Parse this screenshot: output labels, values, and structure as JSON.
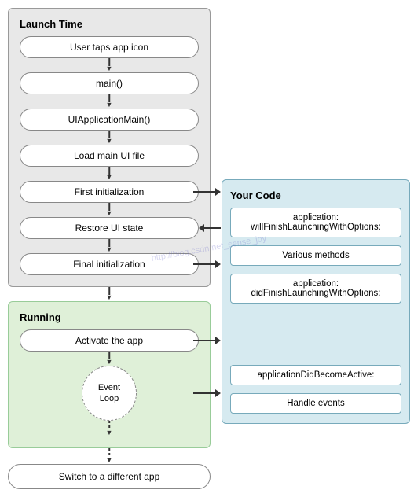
{
  "launch": {
    "label": "Launch Time",
    "boxes": [
      {
        "id": "user-taps",
        "text": "User taps app icon"
      },
      {
        "id": "main",
        "text": "main()"
      },
      {
        "id": "uiappmain",
        "text": "UIApplicationMain()"
      },
      {
        "id": "load-ui",
        "text": "Load main UI file"
      },
      {
        "id": "first-init",
        "text": "First initialization"
      },
      {
        "id": "restore-ui",
        "text": "Restore UI state"
      },
      {
        "id": "final-init",
        "text": "Final initialization"
      }
    ]
  },
  "running": {
    "label": "Running",
    "boxes": [
      {
        "id": "activate",
        "text": "Activate the app"
      }
    ],
    "event_loop": {
      "line1": "Event",
      "line2": "Loop"
    }
  },
  "bottom": {
    "text": "Switch to a different app"
  },
  "your_code": {
    "label": "Your Code",
    "boxes": [
      {
        "id": "will-finish",
        "text": "application:\nwillFinishLaunchingWithOptions:"
      },
      {
        "id": "various",
        "text": "Various methods"
      },
      {
        "id": "did-finish",
        "text": "application:\ndidFinishLaunchingWithOptions:"
      },
      {
        "id": "become-active",
        "text": "applicationDidBecomeActive:"
      },
      {
        "id": "handle-events",
        "text": "Handle events"
      }
    ]
  },
  "watermark": "http://blog.csdn.net_sense_joy"
}
